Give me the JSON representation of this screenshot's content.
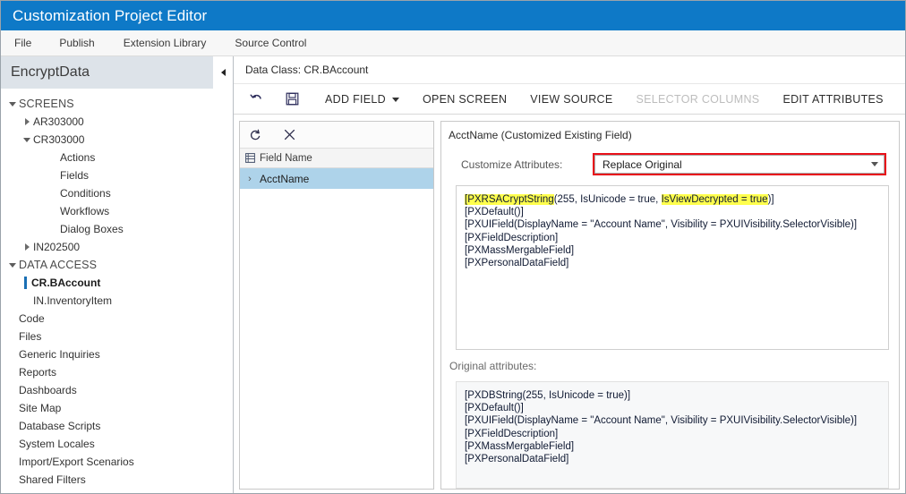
{
  "window": {
    "title": "Customization Project Editor"
  },
  "menubar": {
    "items": [
      {
        "label": "File"
      },
      {
        "label": "Publish"
      },
      {
        "label": "Extension Library"
      },
      {
        "label": "Source Control"
      }
    ]
  },
  "sidebar": {
    "project_name": "EncryptData",
    "collapse_icon": "collapse-left-icon",
    "tree": [
      {
        "label": "SCREENS",
        "level": 0,
        "toggle": "caret-down",
        "group": true
      },
      {
        "label": "AR303000",
        "level": 1,
        "toggle": "caret-right"
      },
      {
        "label": "CR303000",
        "level": 1,
        "toggle": "caret-down"
      },
      {
        "label": "Actions",
        "level": 2,
        "toggle": "none"
      },
      {
        "label": "Fields",
        "level": 2,
        "toggle": "none"
      },
      {
        "label": "Conditions",
        "level": 2,
        "toggle": "none"
      },
      {
        "label": "Workflows",
        "level": 2,
        "toggle": "none"
      },
      {
        "label": "Dialog Boxes",
        "level": 2,
        "toggle": "none"
      },
      {
        "label": "IN202500",
        "level": 1,
        "toggle": "caret-right"
      },
      {
        "label": "DATA ACCESS",
        "level": 0,
        "toggle": "caret-down",
        "group": true
      },
      {
        "label": "CR.BAccount",
        "level": 1,
        "toggle": "none",
        "selected": true
      },
      {
        "label": "IN.InventoryItem",
        "level": 1,
        "toggle": "none"
      },
      {
        "label": "Code",
        "level": 0,
        "toggle": "none"
      },
      {
        "label": "Files",
        "level": 0,
        "toggle": "none"
      },
      {
        "label": "Generic Inquiries",
        "level": 0,
        "toggle": "none"
      },
      {
        "label": "Reports",
        "level": 0,
        "toggle": "none"
      },
      {
        "label": "Dashboards",
        "level": 0,
        "toggle": "none"
      },
      {
        "label": "Site Map",
        "level": 0,
        "toggle": "none"
      },
      {
        "label": "Database Scripts",
        "level": 0,
        "toggle": "none"
      },
      {
        "label": "System Locales",
        "level": 0,
        "toggle": "none"
      },
      {
        "label": "Import/Export Scenarios",
        "level": 0,
        "toggle": "none"
      },
      {
        "label": "Shared Filters",
        "level": 0,
        "toggle": "none"
      }
    ]
  },
  "main": {
    "data_class_label": "Data Class: CR.BAccount",
    "toolbar": {
      "undo_icon": "undo-icon",
      "save_icon": "save-floppy-icon",
      "add_field": "ADD FIELD",
      "open_screen": "OPEN SCREEN",
      "view_source": "VIEW SOURCE",
      "selector_columns": "SELECTOR COLUMNS",
      "edit_attributes": "EDIT ATTRIBUTES"
    },
    "field_list": {
      "refresh_icon": "refresh-icon",
      "delete_icon": "close-x-icon",
      "column_icon": "grid-column-icon",
      "column_header": "Field Name",
      "rows": [
        {
          "name": "AcctName",
          "selected": true,
          "expander": "›"
        }
      ]
    },
    "detail": {
      "field_title": "AcctName (Customized Existing Field)",
      "customize_label": "Customize Attributes:",
      "customize_value": "Replace Original",
      "attributes_edit": [
        {
          "segments": [
            {
              "text": "[PXRSACryptString",
              "highlight": true
            },
            {
              "text": "(255, IsUnicode = true, ",
              "highlight": false
            },
            {
              "text": "IsViewDecrypted = true",
              "highlight": true
            },
            {
              "text": ")]",
              "highlight": false
            }
          ]
        },
        {
          "segments": [
            {
              "text": "[PXDefault()]",
              "highlight": false
            }
          ]
        },
        {
          "segments": [
            {
              "text": "[PXUIField(DisplayName = \"Account Name\", Visibility = PXUIVisibility.SelectorVisible)]",
              "highlight": false
            }
          ]
        },
        {
          "segments": [
            {
              "text": "[PXFieldDescription]",
              "highlight": false
            }
          ]
        },
        {
          "segments": [
            {
              "text": "[PXMassMergableField]",
              "highlight": false
            }
          ]
        },
        {
          "segments": [
            {
              "text": "[PXPersonalDataField]",
              "highlight": false
            }
          ]
        }
      ],
      "original_label": "Original attributes:",
      "attributes_original": [
        "[PXDBString(255, IsUnicode = true)]",
        "[PXDefault()]",
        "[PXUIField(DisplayName = \"Account Name\", Visibility = PXUIVisibility.SelectorVisible)]",
        "[PXFieldDescription]",
        "[PXMassMergableField]",
        "[PXPersonalDataField]"
      ]
    }
  },
  "colors": {
    "titlebar": "#0e79c7",
    "selection": "#aed3ea",
    "highlight": "#ffff4d",
    "red_outline": "#e8101a",
    "tree_marker": "#1a6fb4"
  }
}
